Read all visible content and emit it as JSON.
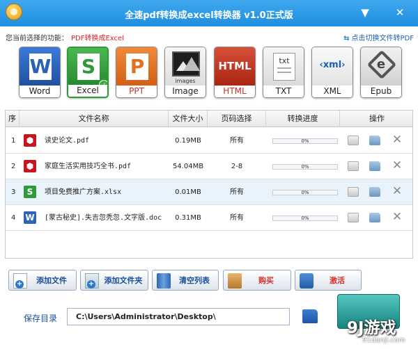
{
  "window": {
    "title": "全速pdf转换成excel转换器 v1.0正式版",
    "minimize_glyph": "▼",
    "close_glyph": "✕"
  },
  "selection": {
    "label": "您当前选择的功能：",
    "mode": "PDF转换成Excel",
    "switch_link": "点击切换文件转PDF"
  },
  "formats": [
    {
      "label": "Word",
      "icon": "word-icon",
      "color": "#2b5fb8"
    },
    {
      "label": "Excel",
      "icon": "excel-icon",
      "color": "#2f9a3a"
    },
    {
      "label": "PPT",
      "icon": "ppt-icon",
      "color": "#e2701e"
    },
    {
      "label": "Image",
      "icon": "image-icon",
      "color": "#2a2a2a"
    },
    {
      "label": "HTML",
      "icon": "html-icon",
      "color": "#c0331f"
    },
    {
      "label": "TXT",
      "icon": "txt-icon",
      "color": "#d8d8d8"
    },
    {
      "label": "XML",
      "icon": "xml-icon",
      "color": "#f0f0f0"
    },
    {
      "label": "Epub",
      "icon": "epub-icon",
      "color": "#dcdcdc"
    }
  ],
  "format_tiles": {
    "word": "W",
    "excel": "S",
    "ppt": "P",
    "image": "images",
    "html": "HTML",
    "txt": "txt",
    "xml": "‹xml›",
    "epub": "e"
  },
  "table": {
    "headers": [
      "序",
      "文件名称",
      "文件大小",
      "页码选择",
      "转换进度",
      "操作"
    ],
    "rows": [
      {
        "index": "1",
        "name": "读史论文.pdf",
        "type": "pdf",
        "size": "0.19MB",
        "pages": "所有",
        "progress": "0%",
        "progress_value": 0
      },
      {
        "index": "2",
        "name": "家庭生活实用技巧全书.pdf",
        "type": "pdf",
        "size": "54.04MB",
        "pages": "2-8",
        "progress": "0%",
        "progress_value": 0
      },
      {
        "index": "3",
        "name": "项目免费推广方案.xlsx",
        "type": "xls",
        "size": "0.01MB",
        "pages": "所有",
        "progress": "0%",
        "progress_value": 0
      },
      {
        "index": "4",
        "name": "[蒙古秘史].失吉忽秃忽.文字版.doc",
        "type": "doc",
        "size": "0.31MB",
        "pages": "所有",
        "progress": "0%",
        "progress_value": 0
      }
    ],
    "file_glyphs": {
      "pdf": "⬢",
      "xls": "S",
      "doc": "W"
    },
    "delete_glyph": "✕"
  },
  "buttons": {
    "add_file": "添加文件",
    "add_folder": "添加文件夹",
    "clear_list": "清空列表",
    "buy": "购买",
    "activate": "激活"
  },
  "save": {
    "label": "保存目录",
    "path": "C:\\Users\\Administrator\\Desktop\\"
  },
  "watermark": {
    "main": "9J游戏",
    "sub": "91danji.com"
  }
}
